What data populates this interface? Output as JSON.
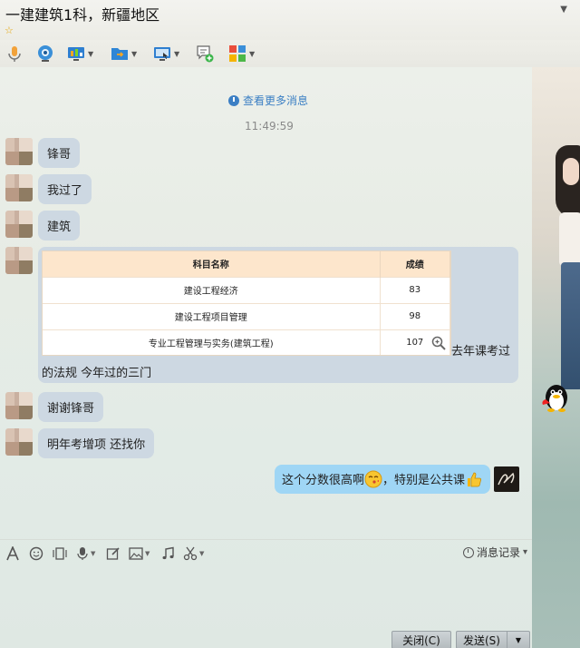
{
  "window": {
    "title": "一建建筑1科，新疆地区",
    "star": "☆",
    "menu_arrow": "▼"
  },
  "toolbar": {
    "items": [
      {
        "name": "voice-call",
        "has_dropdown": false
      },
      {
        "name": "video-call",
        "has_dropdown": false
      },
      {
        "name": "screen-share",
        "has_dropdown": true
      },
      {
        "name": "send-file",
        "has_dropdown": true
      },
      {
        "name": "remote-desktop",
        "has_dropdown": true
      },
      {
        "name": "create-discussion",
        "has_dropdown": false
      },
      {
        "name": "apps",
        "has_dropdown": true
      }
    ]
  },
  "chat": {
    "more_messages": "查看更多消息",
    "timestamp": "11:49:59",
    "messages": [
      {
        "from": "friend",
        "text": "锋哥"
      },
      {
        "from": "friend",
        "text": "我过了"
      },
      {
        "from": "friend",
        "text": "建筑"
      },
      {
        "from": "friend",
        "type": "image"
      },
      {
        "from": "friend",
        "text": "谢谢锋哥"
      },
      {
        "from": "friend",
        "text": "明年考增项 还找你"
      },
      {
        "from": "me",
        "text_before": "这个分数很高啊",
        "text_after": "，特别是公共课"
      }
    ],
    "score_card": {
      "headers": [
        "科目名称",
        "成绩"
      ],
      "rows": [
        {
          "subject": "建设工程经济",
          "score": "83"
        },
        {
          "subject": "建设工程项目管理",
          "score": "98"
        },
        {
          "subject": "专业工程管理与实务(建筑工程)",
          "score": "107"
        }
      ],
      "caption_line1": "去年课考过",
      "caption_line2": "的法规 今年过的三门"
    }
  },
  "editor": {
    "history_label": "消息记录",
    "history_caret": "▾"
  },
  "buttons": {
    "close": "关闭(C)",
    "send": "发送(S)",
    "send_dropdown": "▼"
  },
  "colors": {
    "friend_bubble": "#cdd8e2",
    "my_bubble": "#9fd6f5",
    "link": "#3b7fc4",
    "table_header": "#fde6cc"
  }
}
